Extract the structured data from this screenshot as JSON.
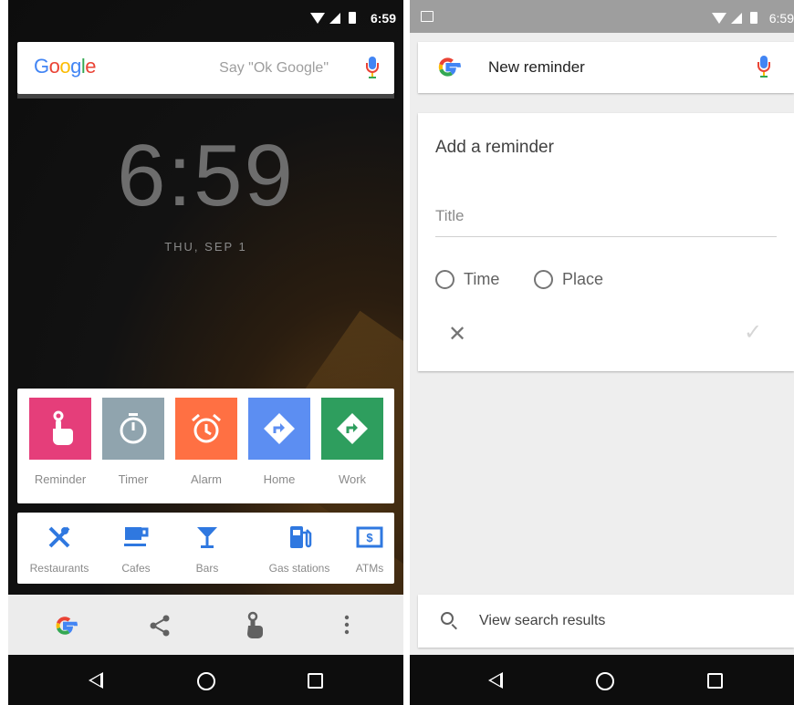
{
  "left": {
    "status_time": "6:59",
    "google_logo": [
      "G",
      "o",
      "o",
      "g",
      "l",
      "e"
    ],
    "search_hint": "Say \"Ok Google\"",
    "lock_time": "6:59",
    "lock_date": "THU, SEP 1",
    "tiles": [
      {
        "label": "Reminder",
        "color": "#e53e7a",
        "icon": "reminder-icon"
      },
      {
        "label": "Timer",
        "color": "#90a4ae",
        "icon": "timer-icon"
      },
      {
        "label": "Alarm",
        "color": "#ff7043",
        "icon": "alarm-icon"
      },
      {
        "label": "Home",
        "color": "#5c8ef2",
        "icon": "directions-icon"
      },
      {
        "label": "Work",
        "color": "#2e9e5e",
        "icon": "directions-icon"
      }
    ],
    "categories": [
      {
        "label": "Restaurants",
        "icon": "restaurant-icon"
      },
      {
        "label": "Cafes",
        "icon": "coffee-icon"
      },
      {
        "label": "Bars",
        "icon": "cocktail-icon"
      },
      {
        "label": "Gas stations",
        "icon": "gas-station-icon"
      },
      {
        "label": "ATMs",
        "icon": "atm-icon"
      }
    ]
  },
  "right": {
    "status_time": "6:59",
    "query": "New reminder",
    "card_title": "Add a reminder",
    "title_placeholder": "Title",
    "option_time": "Time",
    "option_place": "Place",
    "view_results": "View search results"
  },
  "colors": {
    "accent": "#2f78e0",
    "google_blue": "#4285f4",
    "google_red": "#ea4335",
    "google_yellow": "#fbbc05",
    "google_green": "#34a853"
  }
}
